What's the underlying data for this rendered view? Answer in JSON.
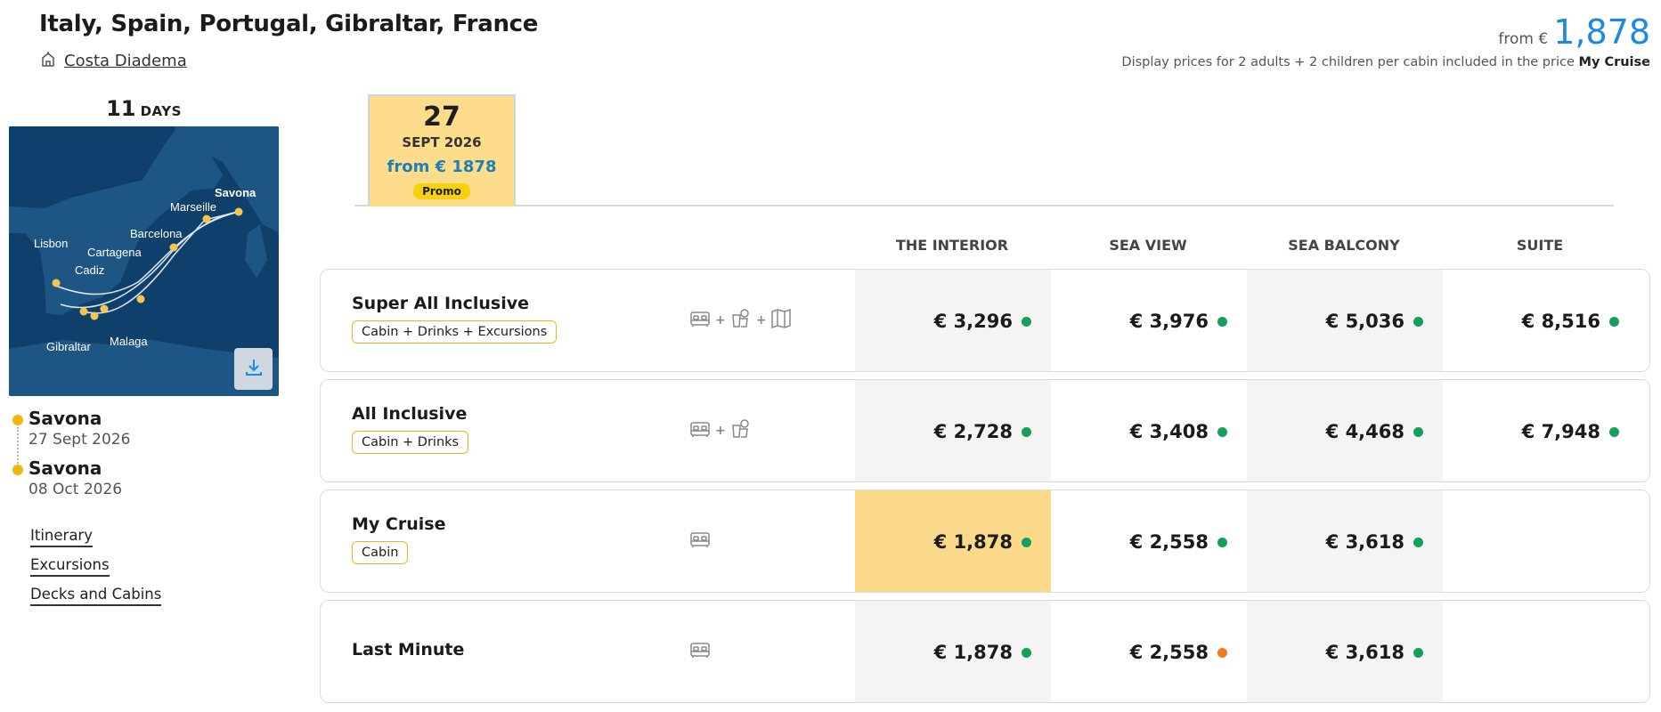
{
  "header": {
    "title": "Italy, Spain, Portugal, Gibraltar, France",
    "ship": "Costa Diadema",
    "from_label": "from €",
    "from_price": "1,878",
    "display_note": "Display prices for 2 adults + 2 children per cabin included in the price",
    "display_note_bold": "My Cruise"
  },
  "itinerary": {
    "days_number": "11",
    "days_unit": "DAYS",
    "map_labels": {
      "savona": "Savona",
      "marseille": "Marseille",
      "barcelona": "Barcelona",
      "lisbon": "Lisbon",
      "cartagena": "Cartagena",
      "cadiz": "Cadiz",
      "gibraltar": "Gibraltar",
      "malaga": "Malaga"
    },
    "departure": {
      "city": "Savona",
      "date": "27 Sept 2026"
    },
    "arrival": {
      "city": "Savona",
      "date": "08 Oct 2026"
    },
    "links": [
      "Itinerary",
      "Excursions",
      "Decks and Cabins"
    ]
  },
  "date_tab": {
    "day": "27",
    "month": "SEPT 2026",
    "price": "from € 1878",
    "badge": "Promo"
  },
  "columns": [
    "THE INTERIOR",
    "SEA VIEW",
    "SEA BALCONY",
    "SUITE"
  ],
  "packages": [
    {
      "name": "Super All Inclusive",
      "tag": "Cabin + Drinks + Excursions",
      "prices": [
        "€ 3,296",
        "€ 3,976",
        "€ 5,036",
        "€ 8,516"
      ],
      "status": [
        "green",
        "green",
        "green",
        "green"
      ]
    },
    {
      "name": "All Inclusive",
      "tag": "Cabin + Drinks",
      "prices": [
        "€ 2,728",
        "€ 3,408",
        "€ 4,468",
        "€ 7,948"
      ],
      "status": [
        "green",
        "green",
        "green",
        "green"
      ]
    },
    {
      "name": "My Cruise",
      "tag": "Cabin",
      "prices": [
        "€ 1,878",
        "€ 2,558",
        "€ 3,618",
        ""
      ],
      "status": [
        "green",
        "green",
        "green",
        ""
      ]
    },
    {
      "name": "Last Minute",
      "tag": "",
      "prices": [
        "€ 1,878",
        "€ 2,558",
        "€ 3,618",
        ""
      ],
      "status": [
        "green",
        "orange",
        "green",
        ""
      ]
    }
  ],
  "colors": {
    "accent_blue": "#1e88e5",
    "promo_yellow": "#f6d20e",
    "highlight": "#fbd98a",
    "status_green": "#14a05c",
    "status_orange": "#f27a1a"
  }
}
